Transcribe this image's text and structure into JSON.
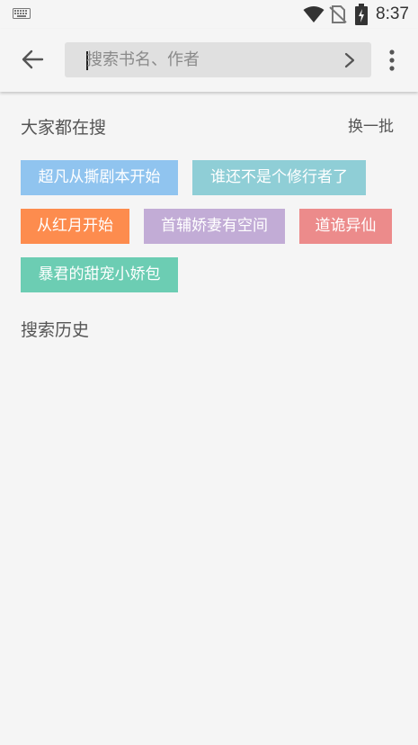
{
  "status_bar": {
    "time": "8:37",
    "icons": [
      "keyboard-icon",
      "wifi-icon",
      "no-sim-icon",
      "battery-charging-icon"
    ]
  },
  "toolbar": {
    "back_icon": "arrow-left-icon",
    "search_placeholder": "搜索书名、作者",
    "search_value": "",
    "go_icon": "chevron-right-icon",
    "more_icon": "more-vert-icon"
  },
  "hot_searches": {
    "title": "大家都在搜",
    "refresh_label": "换一批",
    "tags": [
      {
        "label": "超凡从撕剧本开始",
        "color": "#90c4ef"
      },
      {
        "label": "谁还不是个修行者了",
        "color": "#8fced6"
      },
      {
        "label": "从红月开始",
        "color": "#fd8c4e"
      },
      {
        "label": "首辅娇妻有空间",
        "color": "#c2acd6"
      },
      {
        "label": "道诡异仙",
        "color": "#ec8b8b"
      },
      {
        "label": "暴君的甜宠小娇包",
        "color": "#6ccdb3"
      }
    ]
  },
  "history": {
    "title": "搜索历史"
  }
}
